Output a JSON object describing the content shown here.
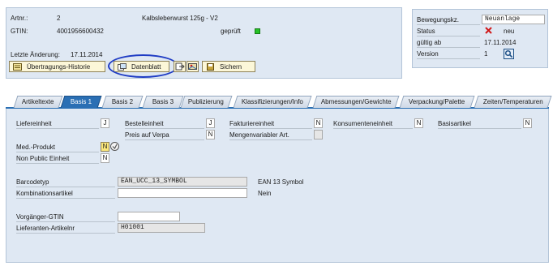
{
  "header": {
    "artnr_label": "Artnr.:",
    "artnr_value": "2",
    "product_name": "Kalbsleberwurst 125g - V2",
    "gtin_label": "GTIN:",
    "gtin_value": "4001956600432",
    "checked_label": "geprüft",
    "last_change_label": "Letzte Änderung:",
    "last_change_value": "17.11.2014",
    "history_button": "Übertragungs-Historie",
    "datasheet_button": "Datenblatt",
    "save_button": "Sichern"
  },
  "movement": {
    "code_label": "Bewegungskz.",
    "code_value": "Neuanlage",
    "status_label": "Status",
    "status_value": "neu",
    "valid_from_label": "gültig ab",
    "valid_from_value": "17.11.2014",
    "version_label": "Version",
    "version_value": "1"
  },
  "tabs": [
    {
      "label": "Artikeltexte"
    },
    {
      "label": "Basis 1"
    },
    {
      "label": "Basis 2"
    },
    {
      "label": "Basis 3"
    },
    {
      "label": "Publizierung"
    },
    {
      "label": "Klassifizierungen/Info"
    },
    {
      "label": "Abmessungen/Gewichte"
    },
    {
      "label": "Verpackung/Palette"
    },
    {
      "label": "Zeiten/Temperaturen"
    }
  ],
  "active_tab": "Basis 1",
  "units": {
    "liefereinheit_label": "Liefereinheit",
    "liefereinheit_value": "J",
    "bestelleinheit_label": "Bestelleinheit",
    "bestelleinheit_value": "J",
    "preis_label": "Preis auf Verpa",
    "preis_value": "N",
    "fakturier_label": "Fakturiereinheit",
    "fakturier_value": "N",
    "mengenvariabel_label": "Mengenvariabler Art.",
    "mengenvariabel_value": "",
    "konsumenten_label": "Konsumenteneinheit",
    "konsumenten_value": "N",
    "basisartikel_label": "Basisartikel",
    "basisartikel_value": "N",
    "med_label": "Med.-Produkt",
    "med_value": "N",
    "nonpublic_label": "Non Public Einheit",
    "nonpublic_value": "N"
  },
  "barcode": {
    "type_label": "Barcodetyp",
    "type_value": "EAN_UCC_13_SYMBOL",
    "type_desc": "EAN 13 Symbol",
    "combo_label": "Kombinationsartikel",
    "combo_value": "",
    "combo_desc": "Nein"
  },
  "predecessor": {
    "gtin_label": "Vorgänger-GTIN",
    "gtin_value": "",
    "supplier_label": "Lieferanten-Artikelnr",
    "supplier_value": "H01001"
  },
  "colors": {
    "panel": "#dfe8f3",
    "active_tab": "#2a6fb4",
    "status_green": "#27c227",
    "status_red": "#d01818",
    "highlight_circle": "#1f3cc4"
  }
}
